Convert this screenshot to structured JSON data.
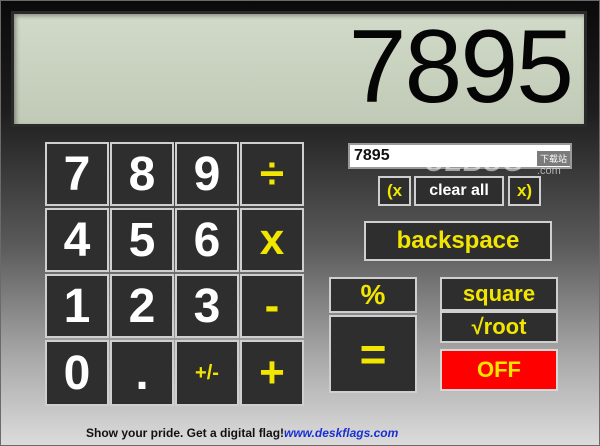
{
  "display": {
    "value": "7895"
  },
  "tape": {
    "value": "7895"
  },
  "watermark": {
    "logo": "UEBUG",
    "badge": "下载站",
    "domain": ".com"
  },
  "keys": {
    "n7": "7",
    "n8": "8",
    "n9": "9",
    "divide": "÷",
    "n4": "4",
    "n5": "5",
    "n6": "6",
    "multiply": "x",
    "n1": "1",
    "n2": "2",
    "n3": "3",
    "minus": "-",
    "n0": "0",
    "decimal": ".",
    "sign": "+/-",
    "plus": "+",
    "open_paren": "(x",
    "clear_all": "clear all",
    "close_paren": "x)",
    "backspace": "backspace",
    "percent": "%",
    "equals": "=",
    "square": "square",
    "root": "√root",
    "off": "OFF"
  },
  "footer": {
    "tagline": "Show your pride. Get a digital flag!",
    "link": "www.deskflags.com"
  },
  "colors": {
    "key_bg": "#2e2e2e",
    "key_border": "#cfcfcf",
    "accent_yellow": "#f2e600",
    "off_red": "#ff0000",
    "lcd": "#c8d1be",
    "link_blue": "#1a2fd1"
  }
}
